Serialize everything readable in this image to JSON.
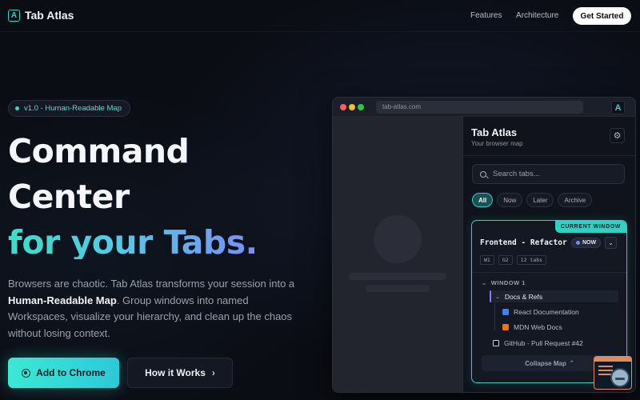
{
  "nav": {
    "brand": "Tab Atlas",
    "logo_glyph": "A",
    "links": [
      "Features",
      "Architecture"
    ],
    "cta": "Get Started"
  },
  "hero": {
    "badge": "v1.0 - Human-Readable Map",
    "title_line1": "Command",
    "title_line2": "Center",
    "title_line3": "for your Tabs.",
    "desc_pre": "Browsers are chaotic. Tab Atlas transforms your session into a ",
    "desc_bold": "Human-Readable Map",
    "desc_post": ". Group windows into named Workspaces, visualize your hierarchy, and clean up the chaos without losing context.",
    "primary_button": "Add to Chrome",
    "secondary_button": "How it Works",
    "secondary_icon": "chevron-right-icon",
    "gradient_colors": [
      "#38e0c8",
      "#56c8e6",
      "#7c8cf4"
    ]
  },
  "mockup": {
    "url": "tab-atlas.com",
    "ext_glyph": "A",
    "panel": {
      "title": "Tab Atlas",
      "subtitle": "Your browser map",
      "search_placeholder": "Search tabs...",
      "filters": [
        "All",
        "Now",
        "Later",
        "Archive"
      ],
      "active_filter": "All",
      "card": {
        "tag": "CURRENT WINDOW",
        "title": "Frontend - Refactor",
        "status": "NOW",
        "chips": [
          "W1",
          "G2",
          "12 tabs"
        ],
        "window_label": "WINDOW 1",
        "group": "Docs & Refs",
        "group_tabs": [
          "React Documentation",
          "MDN Web Docs"
        ],
        "loose_tab": "GitHub - Pull Request #42",
        "collapse": "Collapse Map"
      }
    }
  },
  "colors": {
    "accent": "#2fd0c6",
    "background": "#0b0d14",
    "violet": "#7c8cf4"
  }
}
